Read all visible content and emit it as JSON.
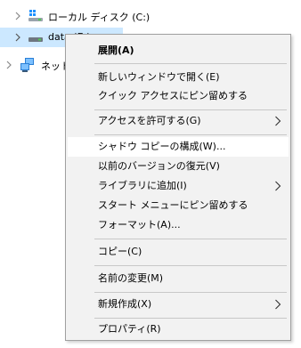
{
  "tree": {
    "local_disk_label": "ローカル ディスク (C:)",
    "data_drive_label": "data (E:)",
    "network_label": "ネットワーク"
  },
  "menu": {
    "expand": "展開(A)",
    "open_new_window": "新しいウィンドウで開く(E)",
    "pin_quick_access": "クイック アクセスにピン留めする",
    "grant_access": "アクセスを許可する(G)",
    "shadow_copy": "シャドウ コピーの構成(W)...",
    "restore_previous": "以前のバージョンの復元(V)",
    "add_to_library": "ライブラリに追加(I)",
    "pin_start": "スタート メニューにピン留めする",
    "format": "フォーマット(A)...",
    "copy": "コピー(C)",
    "rename": "名前の変更(M)",
    "new": "新規作成(X)",
    "properties": "プロパティ(R)"
  }
}
